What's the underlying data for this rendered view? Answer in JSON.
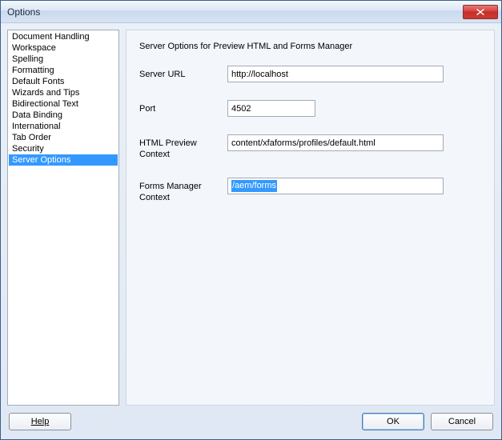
{
  "window": {
    "title": "Options"
  },
  "categories": [
    "Document Handling",
    "Workspace",
    "Spelling",
    "Formatting",
    "Default Fonts",
    "Wizards and Tips",
    "Bidirectional Text",
    "Data Binding",
    "International",
    "Tab Order",
    "Security",
    "Server Options"
  ],
  "selectedCategoryIndex": 11,
  "panel": {
    "title": "Server Options for Preview HTML and Forms Manager",
    "fields": {
      "serverUrl": {
        "label": "Server URL",
        "value": "http://localhost"
      },
      "port": {
        "label": "Port",
        "value": "4502"
      },
      "htmlPreviewContext": {
        "label": "HTML Preview Context",
        "value": "content/xfaforms/profiles/default.html"
      },
      "formsManagerContext": {
        "label": "Forms Manager Context",
        "value": "/aem/forms"
      }
    }
  },
  "buttons": {
    "help": "Help",
    "ok": "OK",
    "cancel": "Cancel"
  }
}
